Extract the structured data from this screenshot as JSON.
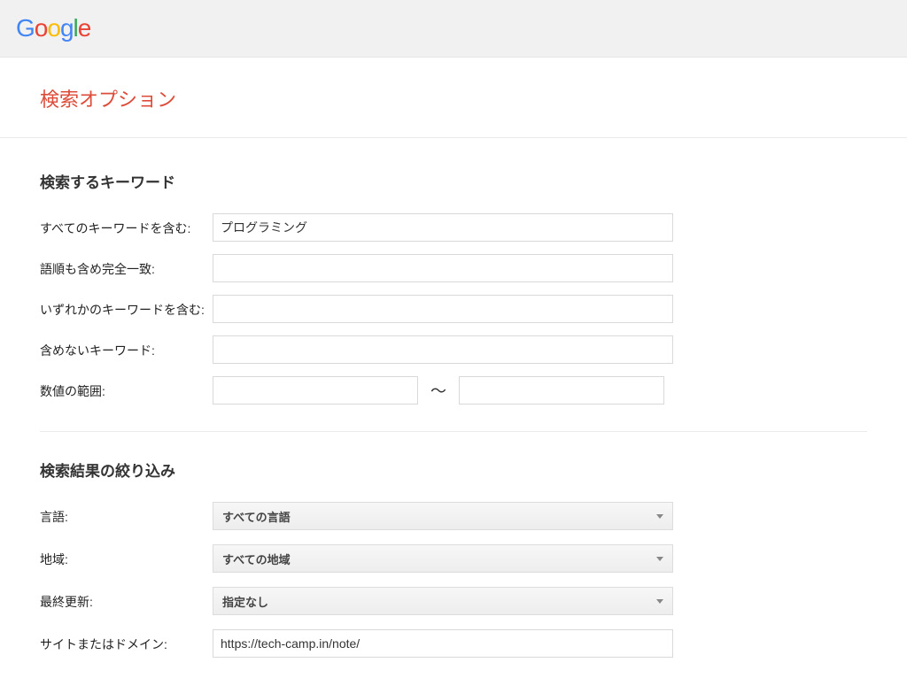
{
  "logo": {
    "g1": "G",
    "o1": "o",
    "o2": "o",
    "g2": "g",
    "l1": "l",
    "e1": "e"
  },
  "page_title": "検索オプション",
  "sections": {
    "keywords": {
      "heading": "検索するキーワード",
      "all_words": {
        "label": "すべてのキーワードを含む:",
        "value": "プログラミング"
      },
      "exact_phrase": {
        "label": "語順も含め完全一致:",
        "value": ""
      },
      "any_words": {
        "label": "いずれかのキーワードを含む:",
        "value": ""
      },
      "none_words": {
        "label": "含めないキーワード:",
        "value": ""
      },
      "number_range": {
        "label": "数値の範囲:",
        "from": "",
        "to": "",
        "sep": "〜"
      }
    },
    "narrow": {
      "heading": "検索結果の絞り込み",
      "language": {
        "label": "言語:",
        "selected": "すべての言語"
      },
      "region": {
        "label": "地域:",
        "selected": "すべての地域"
      },
      "last_update": {
        "label": "最終更新:",
        "selected": "指定なし"
      },
      "site_domain": {
        "label": "サイトまたはドメイン:",
        "value": "https://tech-camp.in/note/"
      }
    }
  }
}
